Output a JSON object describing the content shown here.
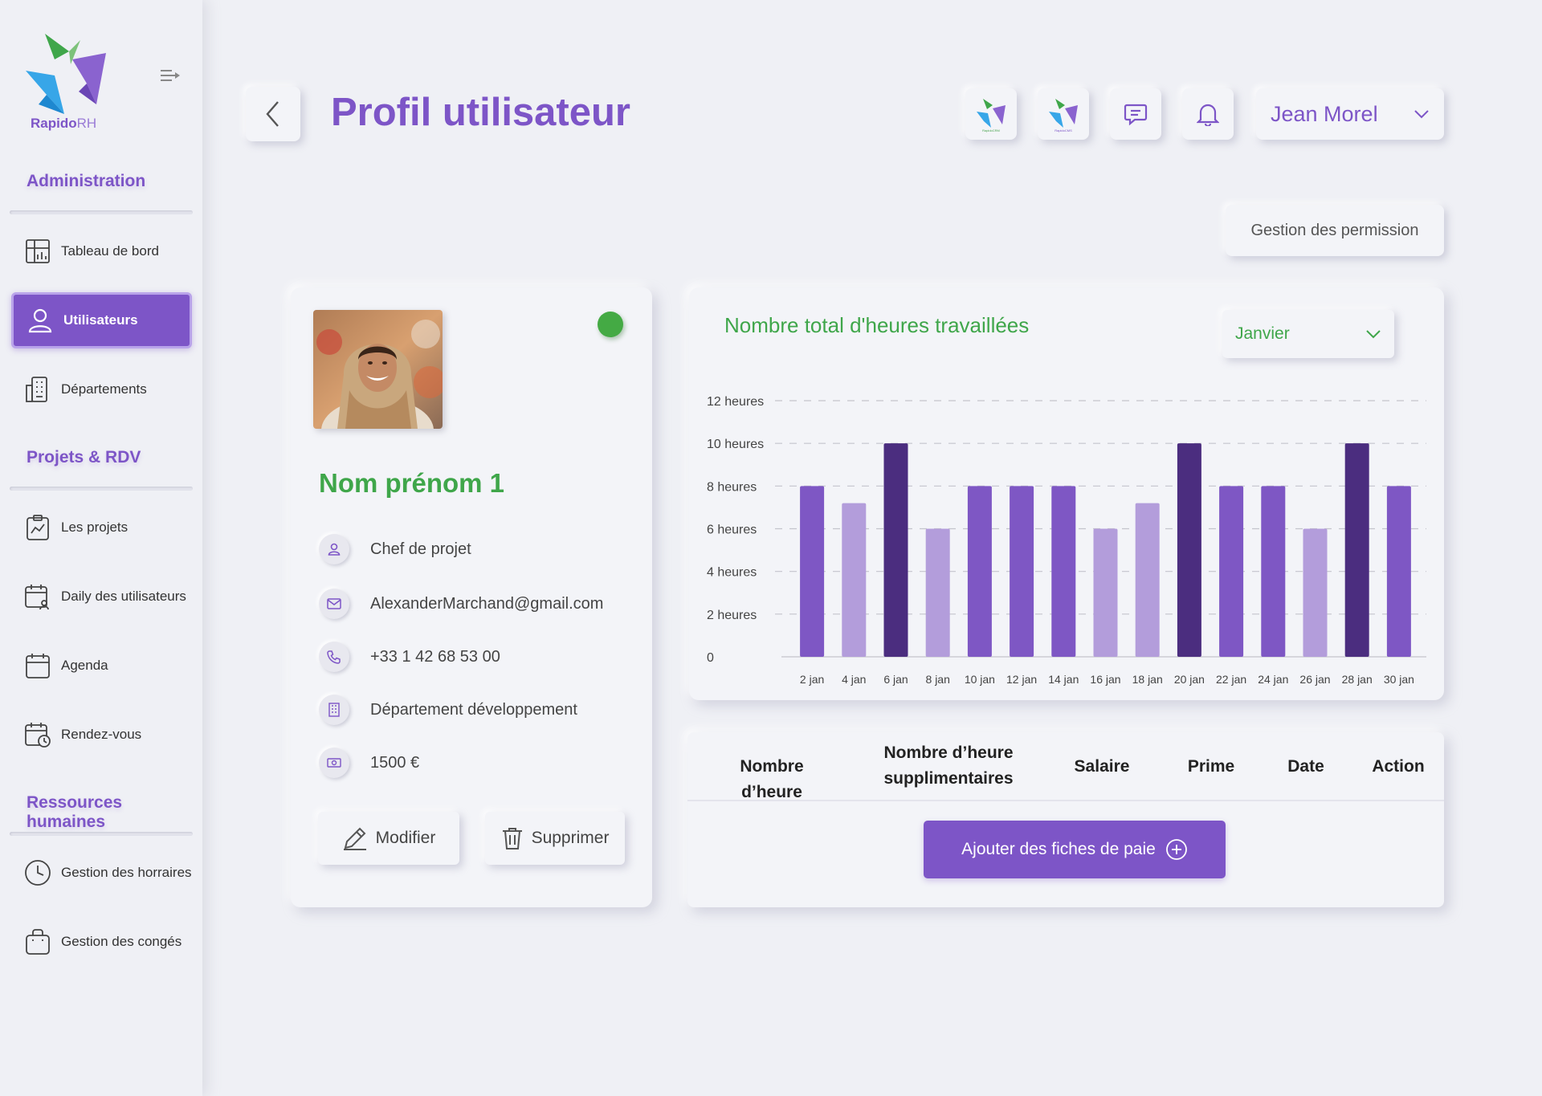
{
  "brand": {
    "name_bold": "Rapido",
    "name_light": "RH"
  },
  "sidebar": {
    "sections": [
      {
        "title": "Administration"
      },
      {
        "title": "Projets & RDV"
      },
      {
        "title": "Ressources humaines"
      }
    ],
    "items": [
      {
        "label": "Tableau de bord",
        "icon": "dashboard-icon",
        "active": false
      },
      {
        "label": "Utilisateurs",
        "icon": "user-icon",
        "active": true
      },
      {
        "label": "Départements",
        "icon": "building-icon",
        "active": false
      },
      {
        "label": "Les projets",
        "icon": "clipboard-chart-icon",
        "active": false
      },
      {
        "label": "Daily des utilisateurs",
        "icon": "calendar-user-icon",
        "active": false
      },
      {
        "label": "Agenda",
        "icon": "calendar-icon",
        "active": false
      },
      {
        "label": "Rendez-vous",
        "icon": "calendar-clock-icon",
        "active": false
      },
      {
        "label": "Gestion des horraires",
        "icon": "clock-icon",
        "active": false
      },
      {
        "label": "Gestion des congés",
        "icon": "bag-icon",
        "active": false
      }
    ]
  },
  "header": {
    "title": "Profil utilisateur",
    "apps": [
      "RapidoCRM",
      "RapidoCMS"
    ],
    "user_name": "Jean Morel",
    "permissions_label": "Gestion des permission"
  },
  "profile": {
    "name": "Nom prénom 1",
    "online": true,
    "role": "Chef de projet",
    "email": "AlexanderMarchand@gmail.com",
    "phone": "+33 1 42 68 53 00",
    "department": "Département développement",
    "salary": "1500 €",
    "edit_label": "Modifier",
    "delete_label": "Supprimer"
  },
  "chart": {
    "month": "Janvier"
  },
  "chart_data": {
    "type": "bar",
    "title": "Nombre total d'heures travaillées",
    "categories": [
      "2 jan",
      "4 jan",
      "6 jan",
      "8 jan",
      "10 jan",
      "12 jan",
      "14 jan",
      "16 jan",
      "18 jan",
      "20 jan",
      "22 jan",
      "24 jan",
      "26 jan",
      "28 jan",
      "30 jan"
    ],
    "values": [
      8,
      7.2,
      10,
      6,
      8,
      8,
      8,
      6,
      7.2,
      10,
      8,
      8,
      6,
      10,
      8
    ],
    "y_ticks": [
      "0",
      "2 heures",
      "4 heures",
      "6 heures",
      "8 heures",
      "10 heures",
      "12 heures"
    ],
    "ylim": [
      0,
      12
    ],
    "grid": true,
    "colors": {
      "max": "#4b2d7f",
      "normal": "#7e57c4",
      "low": "#b39ddb"
    }
  },
  "payslips": {
    "columns": [
      "Nombre d’heure",
      "Nombre d’heure supplimentaires",
      "Salaire",
      "Prime",
      "Date",
      "Action"
    ],
    "rows": [],
    "add_label": "Ajouter des fiches de paie"
  },
  "colors": {
    "accent": "#7d55c7",
    "green": "#3fa64a",
    "background": "#eff0f5"
  }
}
